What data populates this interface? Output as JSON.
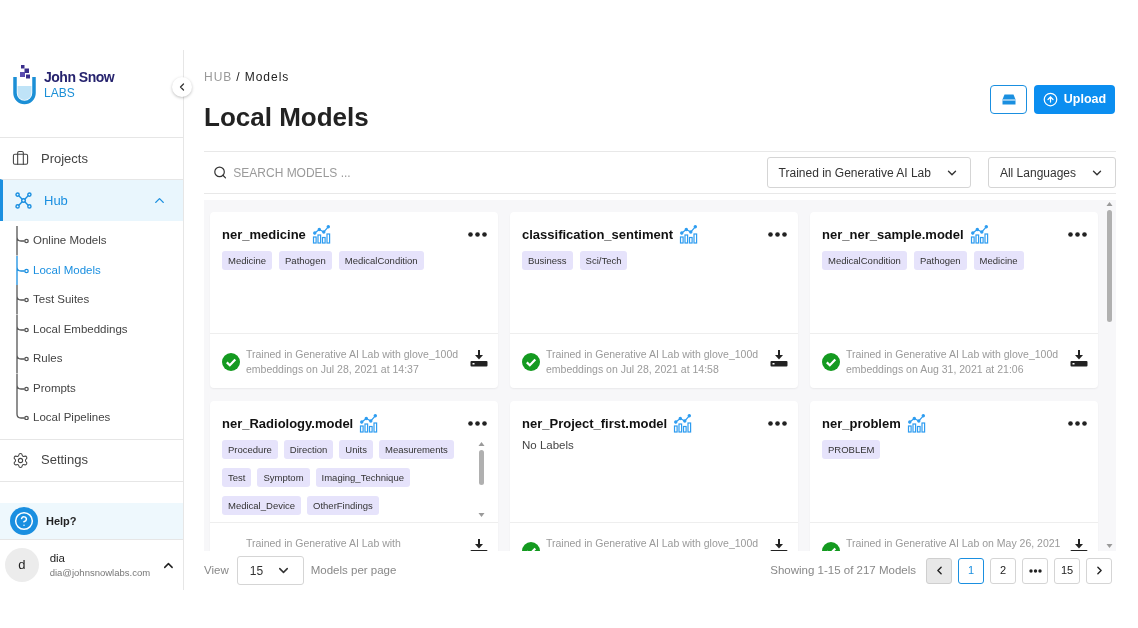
{
  "sidebar": {
    "logo": {
      "name": "John Snow",
      "sub": "LABS"
    },
    "nav": [
      {
        "label": "Projects",
        "selected": false
      },
      {
        "label": "Hub",
        "selected": true,
        "expanded": true,
        "children": [
          {
            "label": "Online Models",
            "selected": false
          },
          {
            "label": "Local Models",
            "selected": true
          },
          {
            "label": "Test Suites",
            "selected": false
          },
          {
            "label": "Local Embeddings",
            "selected": false
          },
          {
            "label": "Rules",
            "selected": false
          },
          {
            "label": "Prompts",
            "selected": false
          },
          {
            "label": "Local Pipelines",
            "selected": false
          }
        ]
      },
      {
        "label": "Settings",
        "selected": false
      }
    ],
    "help": "Help?",
    "user": {
      "initial": "d",
      "name": "dia",
      "email": "dia@johnsnowlabs.com"
    }
  },
  "breadcrumb": {
    "items": [
      "HUB",
      "Models"
    ],
    "separator": "/"
  },
  "title": "Local Models",
  "upload_button": "Upload",
  "search": {
    "placeholder": "SEARCH MODELS ..."
  },
  "filters": [
    {
      "value": "Trained in Generative AI Lab"
    },
    {
      "value": "All Languages"
    }
  ],
  "models": [
    {
      "name": "ner_medicine",
      "labels": [
        "Medicine",
        "Pathogen",
        "MedicalCondition"
      ],
      "verified": true,
      "status": "Trained in Generative AI Lab with glove_100d embeddings on Jul 28, 2021 at 14:37"
    },
    {
      "name": "classification_sentiment",
      "labels": [
        "Business",
        "Sci/Tech"
      ],
      "verified": true,
      "status": "Trained in Generative AI Lab with glove_100d embeddings on Jul 28, 2021 at 14:58"
    },
    {
      "name": "ner_ner_sample.model",
      "labels": [
        "MedicalCondition",
        "Pathogen",
        "Medicine"
      ],
      "verified": true,
      "status": "Trained in Generative AI Lab with glove_100d embeddings on Aug 31, 2021 at 21:06"
    },
    {
      "name": "ner_Radiology.model",
      "labels": [
        "Procedure",
        "Direction",
        "Units",
        "Measurements",
        "Test",
        "Symptom",
        "Imaging_Technique",
        "Medical_Device",
        "OtherFindings"
      ],
      "status": "Trained in Generative AI Lab with"
    },
    {
      "name": "ner_Project_first.model",
      "no_labels": "No Labels",
      "verified": true,
      "status": "Trained in Generative AI Lab with glove_100d"
    },
    {
      "name": "ner_problem",
      "labels": [
        "PROBLEM"
      ],
      "verified": true,
      "status": "Trained in Generative AI Lab on May 26, 2021"
    }
  ],
  "pagination": {
    "view_label": "View",
    "page_size": "15",
    "per_page_label": "Models per page",
    "summary": "Showing 1-15 of 217 Models",
    "prev_disabled": true,
    "pages": [
      {
        "kind": "page",
        "label": "1",
        "selected": true
      },
      {
        "kind": "page",
        "label": "2",
        "selected": false
      },
      {
        "kind": "ellipsis"
      },
      {
        "kind": "page",
        "label": "15",
        "selected": false
      }
    ]
  }
}
